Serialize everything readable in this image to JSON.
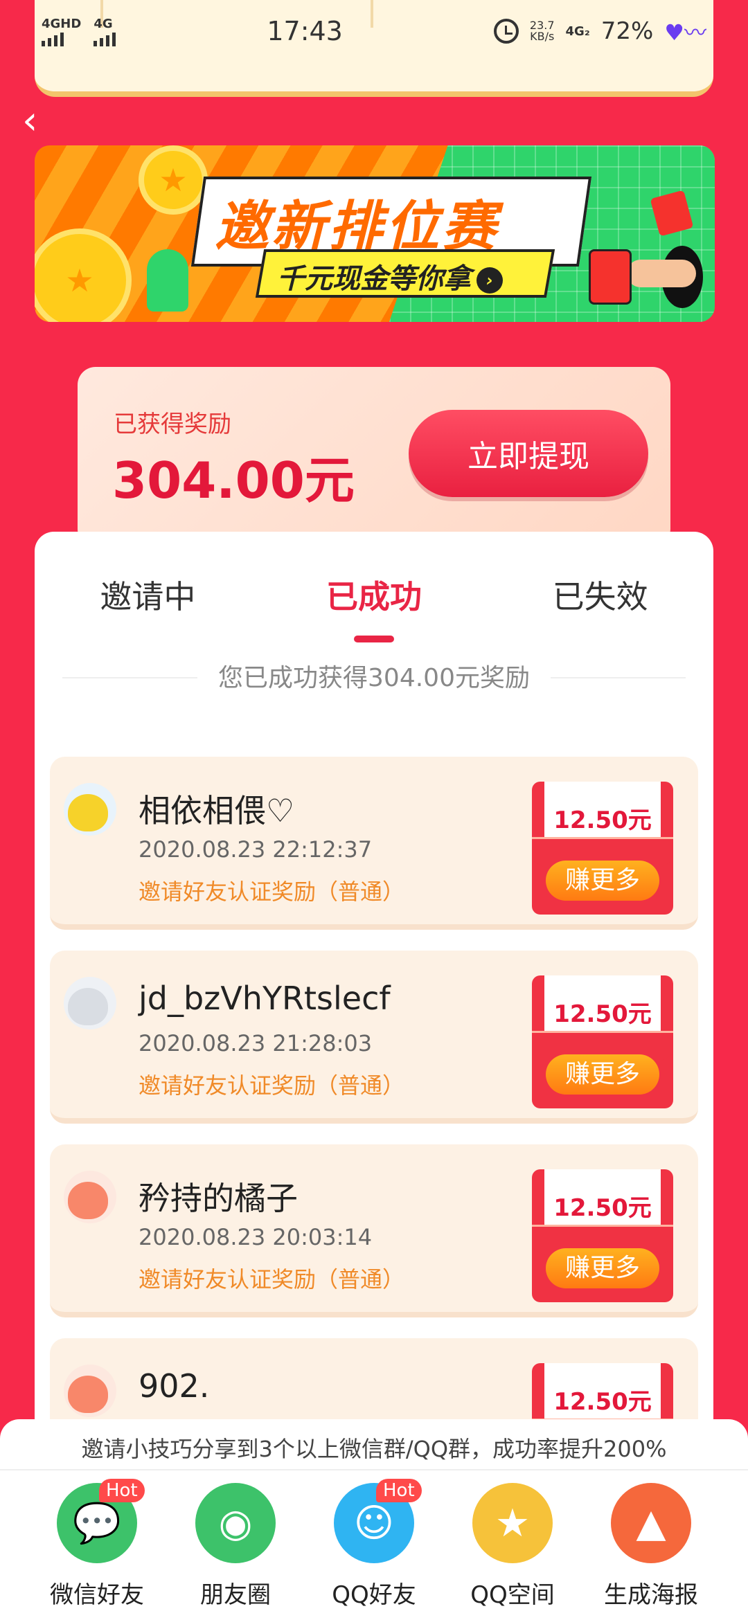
{
  "status_bar": {
    "network_left": "4GHD",
    "network_right": "4G",
    "time": "17:43",
    "speed_value": "23.7",
    "speed_unit": "KB/s",
    "network_type": "4G₂",
    "battery": "72%"
  },
  "banner": {
    "title": "邀新排位赛",
    "subtitle": "千元现金等你拿"
  },
  "reward": {
    "label": "已获得奖励",
    "amount": "304.00元",
    "withdraw_label": "立即提现"
  },
  "tabs": [
    {
      "label": "邀请中"
    },
    {
      "label": "已成功"
    },
    {
      "label": "已失效"
    }
  ],
  "summary": "您已成功获得304.00元奖励",
  "invites": [
    {
      "name": "相依相偎♡",
      "date": "2020.08.23 22:12:37",
      "desc": "邀请好友认证奖励（普通）",
      "amount": "12.50元",
      "button": "赚更多"
    },
    {
      "name": "jd_bzVhYRtslecf",
      "date": "2020.08.23 21:28:03",
      "desc": "邀请好友认证奖励（普通）",
      "amount": "12.50元",
      "button": "赚更多"
    },
    {
      "name": "矜持的橘子",
      "date": "2020.08.23 20:03:14",
      "desc": "邀请好友认证奖励（普通）",
      "amount": "12.50元",
      "button": "赚更多"
    },
    {
      "name": "902.",
      "amount": "12.50元"
    }
  ],
  "share": {
    "tip": "邀请小技巧分享到3个以上微信群/QQ群，成功率提升200%",
    "hot_label": "Hot",
    "items": [
      {
        "label": "微信好友",
        "icon": "wechat-icon",
        "color": "#3dc26a"
      },
      {
        "label": "朋友圈",
        "icon": "moments-icon",
        "color": "#3dc26a"
      },
      {
        "label": "QQ好友",
        "icon": "qq-icon",
        "color": "#2fb4f2"
      },
      {
        "label": "QQ空间",
        "icon": "qzone-icon",
        "color": "#f6c23a"
      },
      {
        "label": "生成海报",
        "icon": "poster-icon",
        "color": "#f5683c"
      }
    ]
  },
  "colors": {
    "background": "#f7294a",
    "accent": "#e92545",
    "orange": "#f08a28"
  }
}
